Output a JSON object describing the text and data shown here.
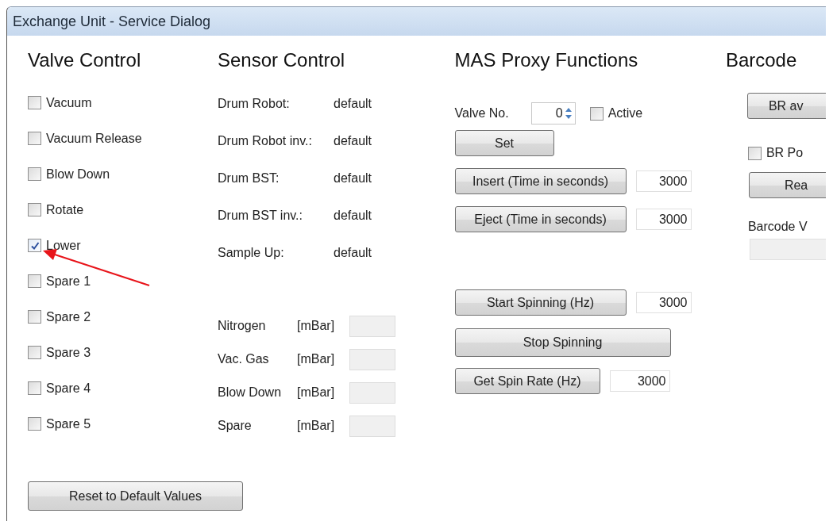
{
  "window": {
    "title": "Exchange Unit - Service Dialog"
  },
  "valve_control": {
    "title": "Valve Control",
    "valves": [
      {
        "label": "Vacuum",
        "checked": false
      },
      {
        "label": "Vacuum Release",
        "checked": false
      },
      {
        "label": "Blow Down",
        "checked": false
      },
      {
        "label": "Rotate",
        "checked": false
      },
      {
        "label": "Lower",
        "checked": true
      },
      {
        "label": "Spare 1",
        "checked": false
      },
      {
        "label": "Spare 2",
        "checked": false
      },
      {
        "label": "Spare 3",
        "checked": false
      },
      {
        "label": "Spare 4",
        "checked": false
      },
      {
        "label": "Spare 5",
        "checked": false
      }
    ],
    "reset_button": "Reset to Default Values"
  },
  "sensor_control": {
    "title": "Sensor Control",
    "sensors": [
      {
        "label": "Drum Robot:",
        "value": "default"
      },
      {
        "label": "Drum Robot inv.:",
        "value": "default"
      },
      {
        "label": "Drum BST:",
        "value": "default"
      },
      {
        "label": "Drum BST inv.:",
        "value": "default"
      },
      {
        "label": "Sample Up:",
        "value": "default"
      }
    ],
    "pressures": [
      {
        "label": "Nitrogen",
        "unit": "[mBar]"
      },
      {
        "label": "Vac. Gas",
        "unit": "[mBar]"
      },
      {
        "label": "Blow Down",
        "unit": "[mBar]"
      },
      {
        "label": "Spare",
        "unit": "[mBar]"
      }
    ]
  },
  "mas_proxy": {
    "title": "MAS Proxy Functions",
    "valve_no": {
      "label": "Valve No.",
      "value": "0"
    },
    "active": {
      "label": "Active",
      "checked": false
    },
    "set_button": "Set",
    "actions": [
      {
        "kind": "timed",
        "label": "Insert (Time in seconds)",
        "value": "3000"
      },
      {
        "kind": "timed",
        "label": "Eject (Time in seconds)",
        "value": "3000"
      },
      {
        "kind": "spin",
        "label": "Start Spinning (Hz)",
        "value": "3000"
      },
      {
        "kind": "wide",
        "label": "Stop Spinning"
      },
      {
        "kind": "rate",
        "label": "Get Spin Rate (Hz)",
        "value": "3000"
      }
    ]
  },
  "barcode": {
    "title": "Barcode",
    "available_button": "BR av",
    "power": {
      "label": "BR Po",
      "checked": false
    },
    "read_button": "Rea",
    "value_label": "Barcode V"
  },
  "annotation": {
    "kind": "arrow"
  }
}
